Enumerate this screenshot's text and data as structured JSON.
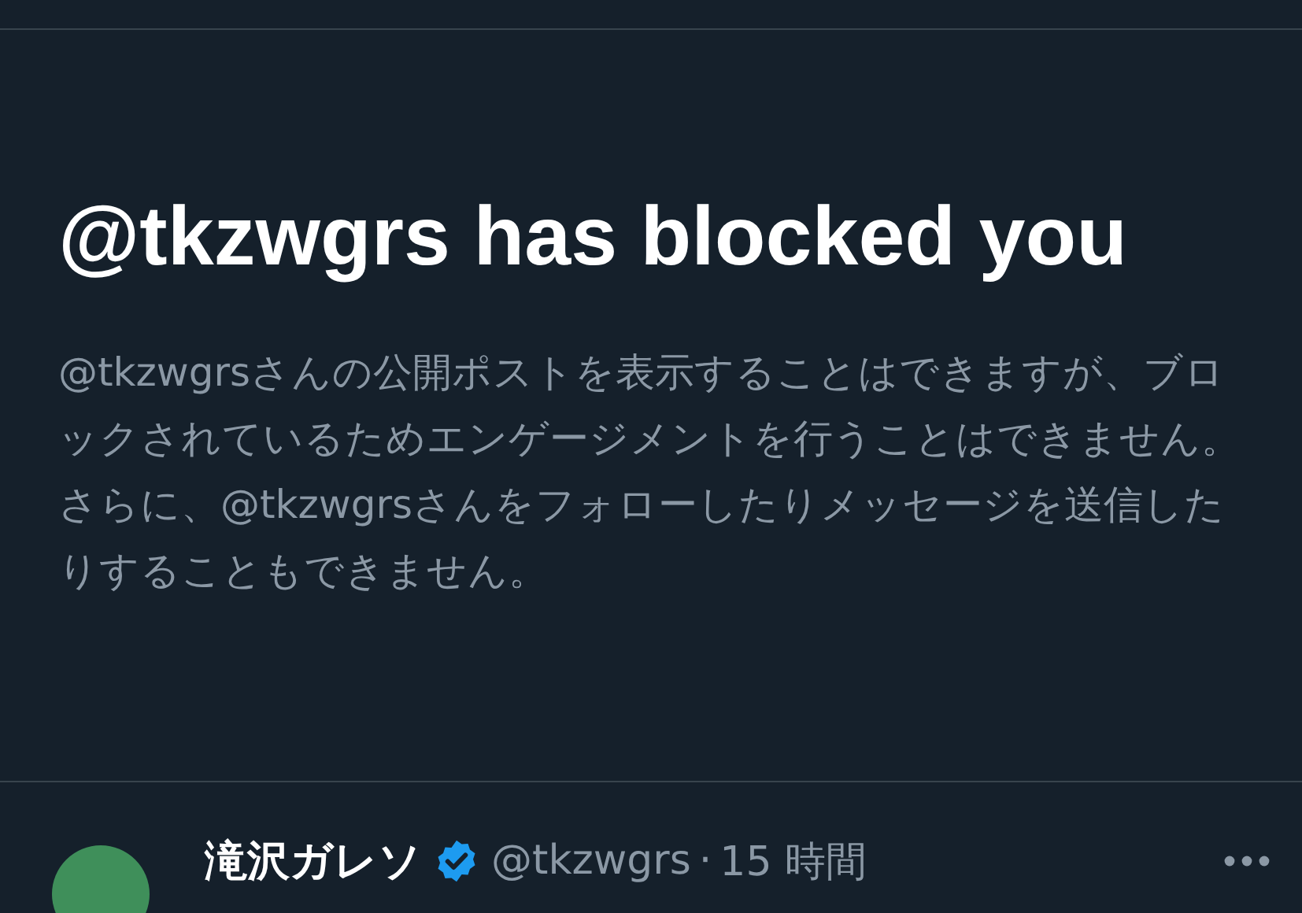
{
  "blocked_notice": {
    "title": "@tkzwgrs has blocked you",
    "message": "@tkzwgrsさんの公開ポストを表示することはできますが、ブロックされているためエンゲージメントを行うことはできません。さらに、@tkzwgrsさんをフォローしたりメッセージを送信したりすることもできません。"
  },
  "post": {
    "author": "滝沢ガレソ",
    "verified": true,
    "handle": "@tkzwgrs",
    "separator": "·",
    "time": "15 時間"
  }
}
